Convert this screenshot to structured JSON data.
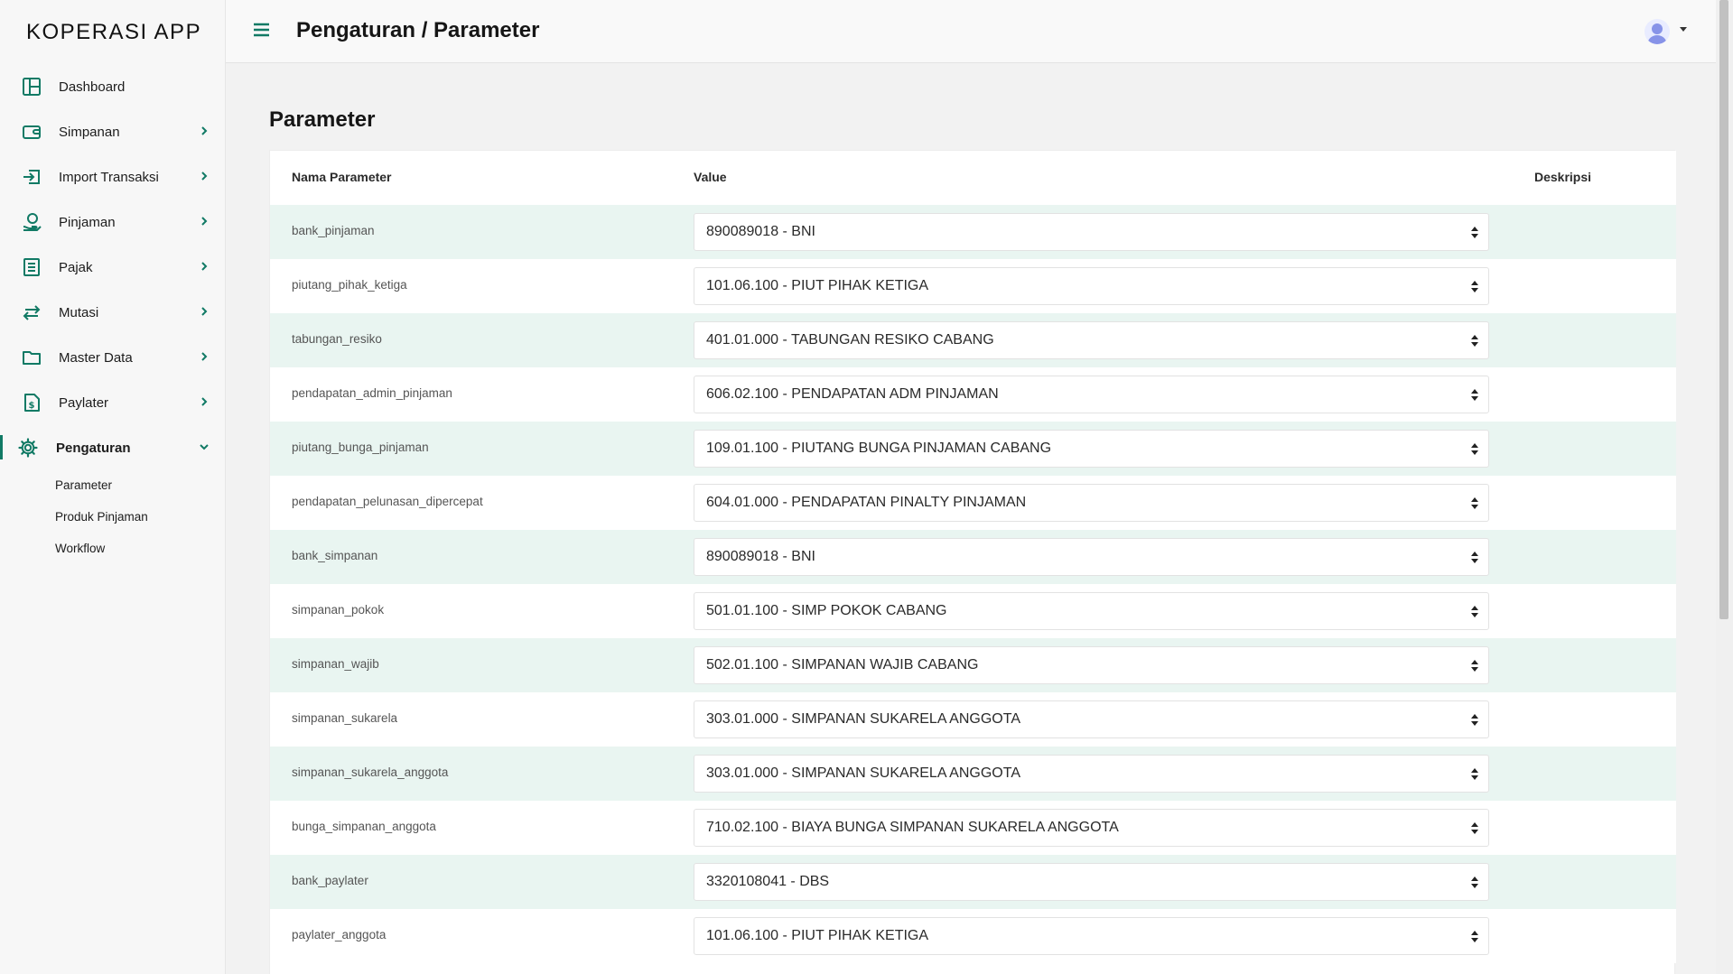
{
  "app": {
    "brand": "KOPERASI APP"
  },
  "header": {
    "breadcrumb": "Pengaturan / Parameter"
  },
  "sidebar": {
    "items": [
      {
        "label": "Dashboard"
      },
      {
        "label": "Simpanan"
      },
      {
        "label": "Import Transaksi"
      },
      {
        "label": "Pinjaman"
      },
      {
        "label": "Pajak"
      },
      {
        "label": "Mutasi"
      },
      {
        "label": "Master Data"
      },
      {
        "label": "Paylater"
      },
      {
        "label": "Pengaturan"
      }
    ],
    "subitems": [
      {
        "label": "Parameter"
      },
      {
        "label": "Produk Pinjaman"
      },
      {
        "label": "Workflow"
      }
    ]
  },
  "main": {
    "title": "Parameter",
    "columns": {
      "name": "Nama Parameter",
      "value": "Value",
      "desc": "Deskripsi"
    },
    "rows": [
      {
        "name": "bank_pinjaman",
        "value": "890089018 - BNI"
      },
      {
        "name": "piutang_pihak_ketiga",
        "value": "101.06.100 - PIUT PIHAK KETIGA"
      },
      {
        "name": "tabungan_resiko",
        "value": "401.01.000 - TABUNGAN RESIKO CABANG"
      },
      {
        "name": "pendapatan_admin_pinjaman",
        "value": "606.02.100 - PENDAPATAN ADM PINJAMAN"
      },
      {
        "name": "piutang_bunga_pinjaman",
        "value": "109.01.100 - PIUTANG BUNGA PINJAMAN CABANG"
      },
      {
        "name": "pendapatan_pelunasan_dipercepat",
        "value": "604.01.000 - PENDAPATAN PINALTY PINJAMAN"
      },
      {
        "name": "bank_simpanan",
        "value": "890089018 - BNI"
      },
      {
        "name": "simpanan_pokok",
        "value": "501.01.100 - SIMP POKOK CABANG"
      },
      {
        "name": "simpanan_wajib",
        "value": "502.01.100 - SIMPANAN WAJIB CABANG"
      },
      {
        "name": "simpanan_sukarela",
        "value": "303.01.000 - SIMPANAN SUKARELA ANGGOTA"
      },
      {
        "name": "simpanan_sukarela_anggota",
        "value": "303.01.000 - SIMPANAN SUKARELA ANGGOTA"
      },
      {
        "name": "bunga_simpanan_anggota",
        "value": "710.02.100 - BIAYA BUNGA SIMPANAN SUKARELA ANGGOTA"
      },
      {
        "name": "bank_paylater",
        "value": "3320108041 - DBS"
      },
      {
        "name": "paylater_anggota",
        "value": "101.06.100 - PIUT PIHAK KETIGA"
      }
    ]
  },
  "colors": {
    "accent": "#117a65",
    "row_stripe": "#e9f5f1",
    "sidebar_bg": "#f7f7f7"
  },
  "icons": [
    "dashboard-icon",
    "wallet-icon",
    "import-icon",
    "loan-icon",
    "tax-icon",
    "transfer-icon",
    "folder-icon",
    "invoice-icon",
    "gear-icon",
    "hamburger-icon",
    "avatar-icon",
    "caret-down-icon",
    "chevron-right-icon",
    "chevron-down-icon",
    "select-arrows-icon"
  ]
}
